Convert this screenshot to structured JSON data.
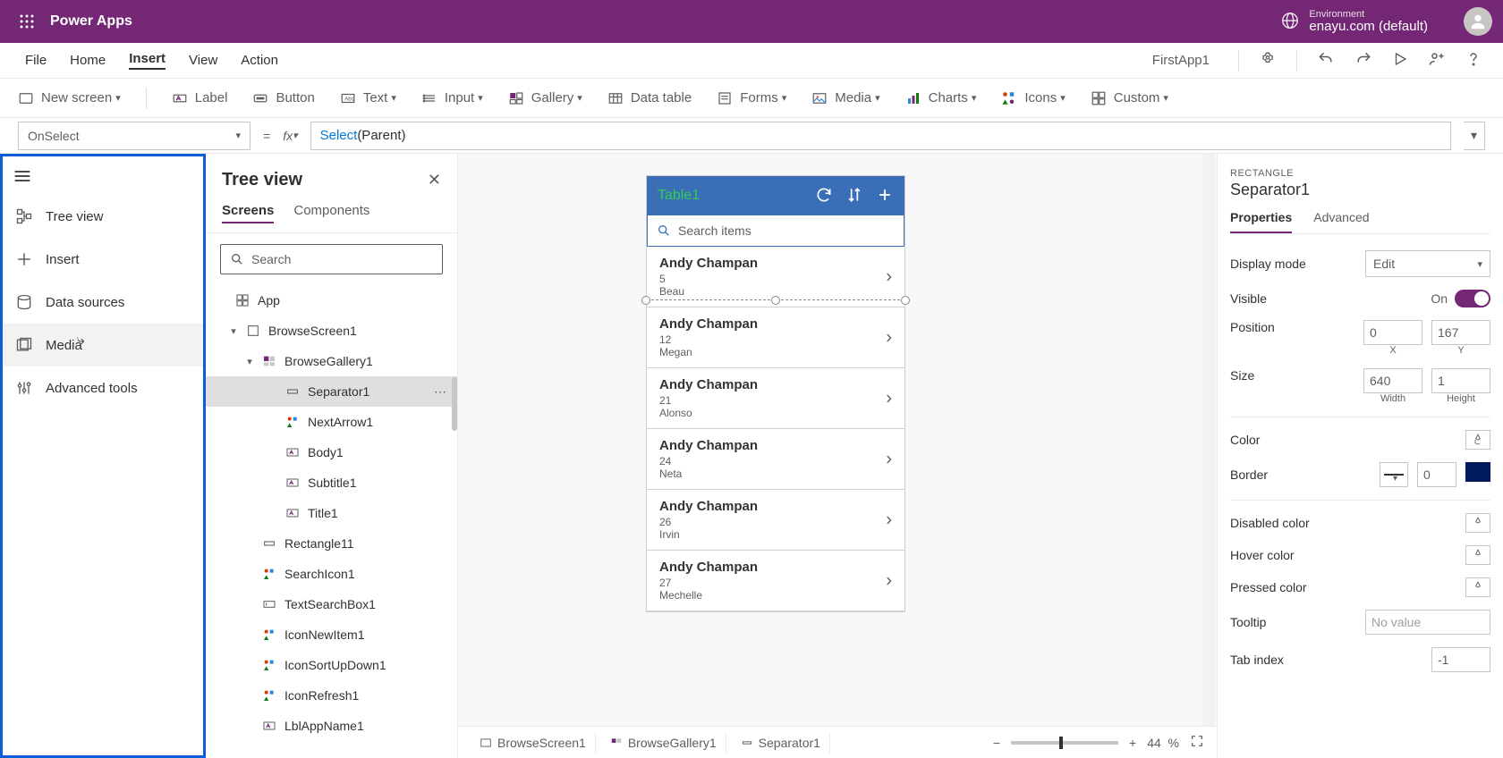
{
  "header": {
    "app_title": "Power Apps",
    "env_label": "Environment",
    "env_name": "enayu.com (default)"
  },
  "menubar": {
    "items": [
      "File",
      "Home",
      "Insert",
      "View",
      "Action"
    ],
    "active_index": 2,
    "app_name": "FirstApp1"
  },
  "ribbon": {
    "new_screen": "New screen",
    "label": "Label",
    "button": "Button",
    "text": "Text",
    "input": "Input",
    "gallery": "Gallery",
    "data_table": "Data table",
    "forms": "Forms",
    "media": "Media",
    "charts": "Charts",
    "icons": "Icons",
    "custom": "Custom"
  },
  "formula": {
    "property": "OnSelect",
    "fn": "Select",
    "arg": "(Parent)"
  },
  "leftbar": {
    "items": [
      "Tree view",
      "Insert",
      "Data sources",
      "Media",
      "Advanced tools"
    ]
  },
  "treepanel": {
    "title": "Tree view",
    "tabs": [
      "Screens",
      "Components"
    ],
    "search_placeholder": "Search",
    "items": [
      {
        "label": "App",
        "indent": 0,
        "icon": "app"
      },
      {
        "label": "BrowseScreen1",
        "indent": 1,
        "icon": "screen",
        "chev": "down"
      },
      {
        "label": "BrowseGallery1",
        "indent": 2,
        "icon": "gallery",
        "chev": "down"
      },
      {
        "label": "Separator1",
        "indent": 3,
        "icon": "rect",
        "selected": true
      },
      {
        "label": "NextArrow1",
        "indent": 3,
        "icon": "iconctrl"
      },
      {
        "label": "Body1",
        "indent": 3,
        "icon": "labelctrl"
      },
      {
        "label": "Subtitle1",
        "indent": 3,
        "icon": "labelctrl"
      },
      {
        "label": "Title1",
        "indent": 3,
        "icon": "labelctrl"
      },
      {
        "label": "Rectangle11",
        "indent": 2,
        "icon": "rect"
      },
      {
        "label": "SearchIcon1",
        "indent": 2,
        "icon": "iconctrl"
      },
      {
        "label": "TextSearchBox1",
        "indent": 2,
        "icon": "textbox"
      },
      {
        "label": "IconNewItem1",
        "indent": 2,
        "icon": "iconctrl"
      },
      {
        "label": "IconSortUpDown1",
        "indent": 2,
        "icon": "iconctrl"
      },
      {
        "label": "IconRefresh1",
        "indent": 2,
        "icon": "iconctrl"
      },
      {
        "label": "LblAppName1",
        "indent": 2,
        "icon": "labelctrl"
      }
    ]
  },
  "canvas": {
    "title": "Table1",
    "search_placeholder": "Search items",
    "rows": [
      {
        "title": "Andy Champan",
        "sub1": "5",
        "sub2": "Beau"
      },
      {
        "title": "Andy Champan",
        "sub1": "12",
        "sub2": "Megan"
      },
      {
        "title": "Andy Champan",
        "sub1": "21",
        "sub2": "Alonso"
      },
      {
        "title": "Andy Champan",
        "sub1": "24",
        "sub2": "Neta"
      },
      {
        "title": "Andy Champan",
        "sub1": "26",
        "sub2": "Irvin"
      },
      {
        "title": "Andy Champan",
        "sub1": "27",
        "sub2": "Mechelle"
      }
    ]
  },
  "props": {
    "type": "RECTANGLE",
    "name": "Separator1",
    "tabs": [
      "Properties",
      "Advanced"
    ],
    "display_mode_label": "Display mode",
    "display_mode_value": "Edit",
    "visible_label": "Visible",
    "visible_value": "On",
    "position_label": "Position",
    "pos_x": "0",
    "pos_y": "167",
    "x_label": "X",
    "y_label": "Y",
    "size_label": "Size",
    "width": "640",
    "height": "1",
    "w_label": "Width",
    "h_label": "Height",
    "color_label": "Color",
    "border_label": "Border",
    "border_value": "0",
    "disabled_color_label": "Disabled color",
    "hover_color_label": "Hover color",
    "pressed_color_label": "Pressed color",
    "tooltip_label": "Tooltip",
    "tooltip_placeholder": "No value",
    "tab_index_label": "Tab index",
    "tab_index_value": "-1"
  },
  "breadcrumb": {
    "items": [
      "BrowseScreen1",
      "BrowseGallery1",
      "Separator1"
    ],
    "zoom": "44"
  }
}
